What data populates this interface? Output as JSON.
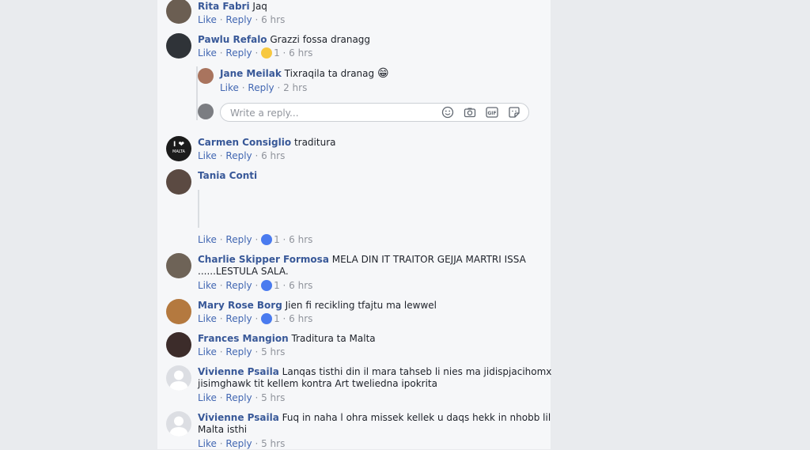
{
  "comments": [
    {
      "name": "Rita Fabri",
      "text": "Jaq",
      "like": "Like",
      "reply": "Reply",
      "time": "6 hrs"
    },
    {
      "name": "Pawlu Refalo",
      "text": "Grazzi fossa dranagg",
      "like": "Like",
      "reply": "Reply",
      "reaction_count": "1",
      "reaction": "haha",
      "time": "6 hrs"
    },
    {
      "name": "Carmen Consiglio",
      "text": "traditura",
      "like": "Like",
      "reply": "Reply",
      "time": "6 hrs"
    },
    {
      "name": "Tania Conti",
      "text": "",
      "like": "Like",
      "reply": "Reply",
      "reaction_count": "1",
      "reaction": "like",
      "time": "6 hrs"
    },
    {
      "name": "Charlie Skipper Formosa",
      "text": "MELA DIN IT TRAITOR GEJJA MARTRI ISSA",
      "text2": "......LESTULA SALA.",
      "like": "Like",
      "reply": "Reply",
      "reaction_count": "1",
      "reaction": "like",
      "time": "6 hrs"
    },
    {
      "name": "Mary Rose Borg",
      "text": "Jien fi recikling tfajtu ma lewwel",
      "like": "Like",
      "reply": "Reply",
      "reaction_count": "1",
      "reaction": "like",
      "time": "6 hrs"
    },
    {
      "name": "Frances Mangion",
      "text": "Traditura ta Malta",
      "like": "Like",
      "reply": "Reply",
      "time": "5 hrs"
    },
    {
      "name": "Vivienne Psaila",
      "text": "Lanqas tisthi din il mara tahseb li nies ma jidispjacihomx",
      "text2": "jisimghawk tit kellem kontra Art tweliedna ipokrita",
      "like": "Like",
      "reply": "Reply",
      "time": "5 hrs"
    },
    {
      "name": "Vivienne Psaila",
      "text": "Fuq in naha l ohra missek kellek u daqs hekk in nhobb lil",
      "text2": "Malta isthi",
      "like": "Like",
      "reply": "Reply",
      "time": "5 hrs"
    }
  ],
  "nested_reply": {
    "name": "Jane Meilak",
    "text": "Tixraqila ta dranag",
    "emoji": "😁",
    "like": "Like",
    "reply": "Reply",
    "time": "2 hrs"
  },
  "reply_box": {
    "placeholder": "Write a reply..."
  },
  "avatar_badge": {
    "text_top": "I ❤",
    "text_bottom": "MALTA"
  },
  "icons": [
    "smiley-icon",
    "camera-icon",
    "gif-icon",
    "sticker-icon"
  ],
  "colors": {
    "link": "#385898",
    "meta_link": "#4267b2",
    "time": "#90949c",
    "like_reaction": "#4a7bef"
  }
}
